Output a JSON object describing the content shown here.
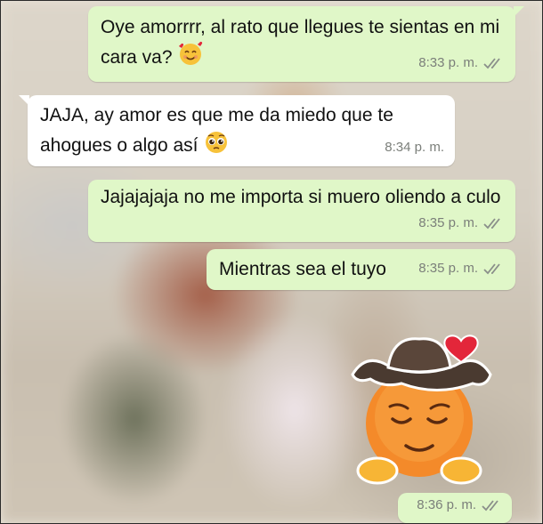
{
  "messages": [
    {
      "direction": "outgoing",
      "text": "Oye amorrrr, al rato que llegues te sientas en mi cara va?",
      "emoji": "smiling-face-with-hearts",
      "time": "8:33 p. m.",
      "status": "read"
    },
    {
      "direction": "incoming",
      "text": "JAJA, ay amor es que me da miedo que te ahogues o algo así",
      "emoji": "pleading-face",
      "time": "8:34 p. m."
    },
    {
      "direction": "outgoing",
      "text": "Jajajajaja no me importa si muero oliendo a culo",
      "time": "8:35 p. m.",
      "status": "read"
    },
    {
      "direction": "outgoing",
      "text": "Mientras sea el tuyo",
      "time": "8:35 p. m.",
      "status": "read"
    },
    {
      "direction": "outgoing",
      "sticker": "pensive-cowboy-with-heart",
      "time": "8:36 p. m.",
      "status": "read"
    }
  ],
  "colors": {
    "outgoing_bubble": "#e0f7c8",
    "incoming_bubble": "#ffffff",
    "meta_text": "#7b7f7a",
    "tick": "#8a8f8a"
  }
}
